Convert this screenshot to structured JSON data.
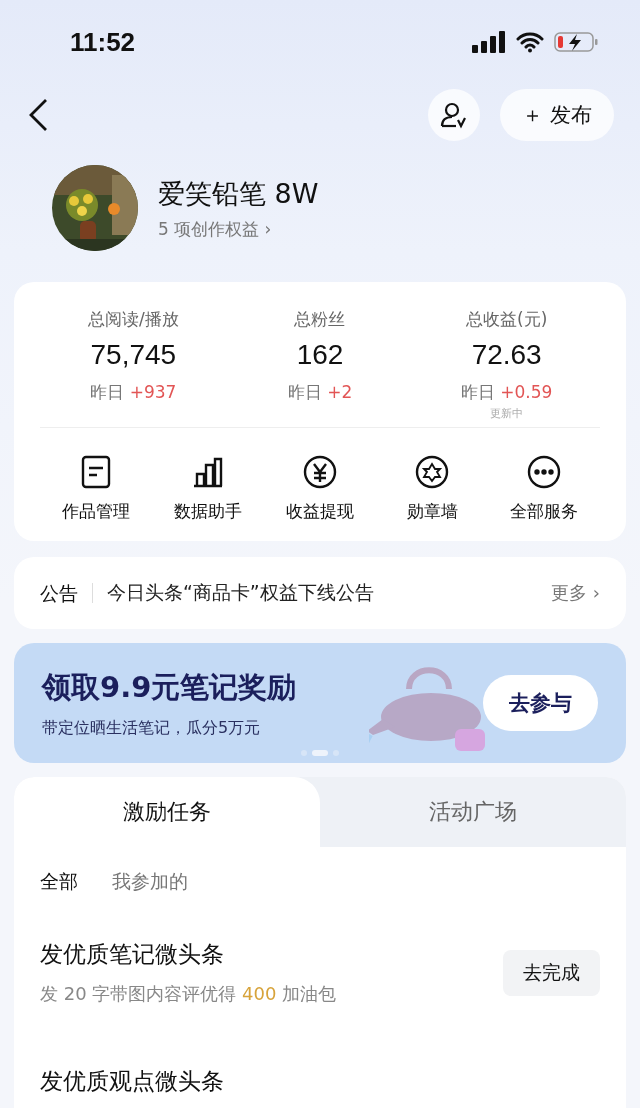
{
  "status_bar": {
    "time": "11:52"
  },
  "nav": {
    "publish_label": "＋ 发布"
  },
  "profile": {
    "name": "爱笑铅笔 8W",
    "rights": "5 项创作权益 ›"
  },
  "stats": [
    {
      "label": "总阅读/播放",
      "value": "75,745",
      "prefix": "昨日",
      "delta": "+937"
    },
    {
      "label": "总粉丝",
      "value": "162",
      "prefix": "昨日",
      "delta": "+2"
    },
    {
      "label": "总收益(元)",
      "value": "72.63",
      "prefix": "昨日",
      "delta": "+0.59",
      "note": "更新中"
    }
  ],
  "services": [
    {
      "kind": "document",
      "label": "作品管理"
    },
    {
      "kind": "chart",
      "label": "数据助手"
    },
    {
      "kind": "yen",
      "label": "收益提现"
    },
    {
      "kind": "badge",
      "label": "勋章墙"
    },
    {
      "kind": "more",
      "label": "全部服务"
    }
  ],
  "notice": {
    "tag": "公告",
    "text": "今日头条“商品卡”权益下线公告",
    "more": "更多 ›"
  },
  "banner": {
    "title": "领取9.9元笔记奖励",
    "subtitle": "带定位晒生活笔记，瓜分5万元",
    "button": "去参与",
    "dots": [
      {
        "selected": false
      },
      {
        "selected": true
      },
      {
        "selected": false
      }
    ]
  },
  "tabs": [
    {
      "label": "激励任务",
      "selected": true
    },
    {
      "label": "活动广场",
      "selected": false
    }
  ],
  "filters": [
    {
      "label": "全部",
      "selected": true
    },
    {
      "label": "我参加的",
      "selected": false
    }
  ],
  "tasks": [
    {
      "title": "发优质笔记微头条",
      "description": "发 20 字带图内容评优得 **400** 加油包",
      "button": "去完成"
    },
    {
      "title": "发优质观点微头条"
    }
  ]
}
